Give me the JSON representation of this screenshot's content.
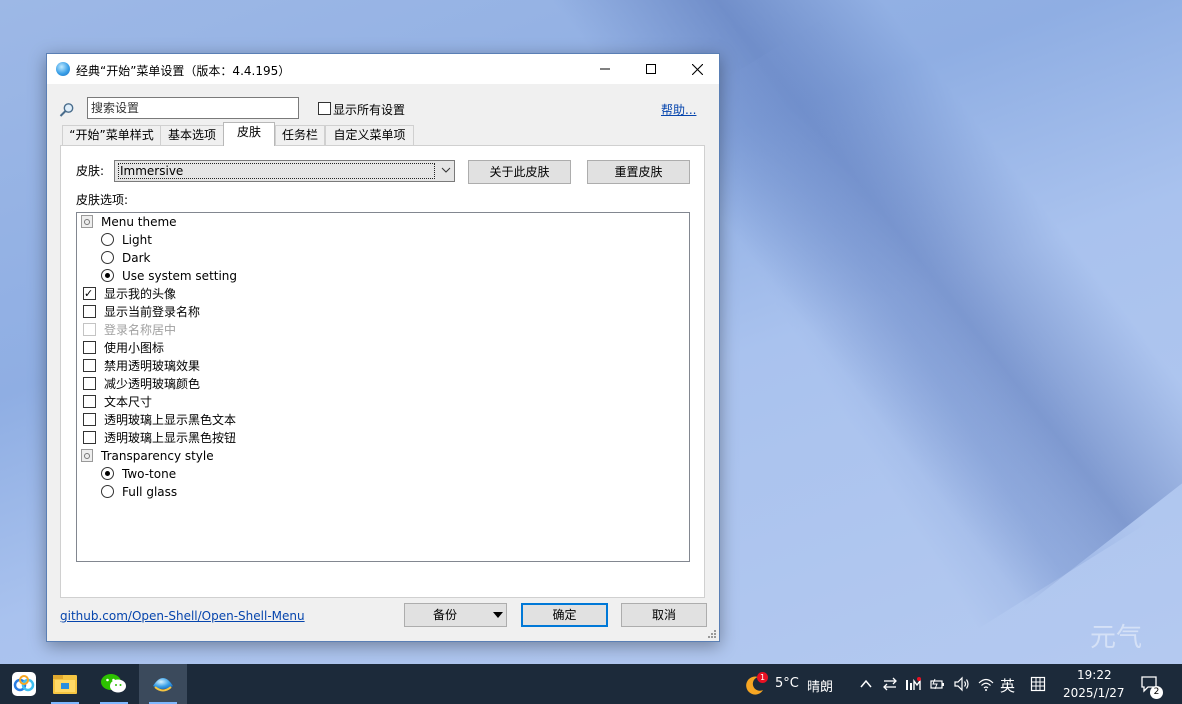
{
  "window": {
    "title": "经典“开始”菜单设置（版本：4.4.195）"
  },
  "search": {
    "placeholder": "搜索设置",
    "show_all_label": "显示所有设置",
    "help_link": "帮助..."
  },
  "tabs": [
    {
      "label": "“开始”菜单样式"
    },
    {
      "label": "基本选项"
    },
    {
      "label": "皮肤",
      "active": true
    },
    {
      "label": "任务栏"
    },
    {
      "label": "自定义菜单项"
    }
  ],
  "skin": {
    "label": "皮肤:",
    "selected": "Immersive",
    "about_button": "关于此皮肤",
    "reset_button": "重置皮肤",
    "options_label": "皮肤选项:"
  },
  "options": [
    {
      "type": "group",
      "label": "Menu theme"
    },
    {
      "type": "radio",
      "label": "Light",
      "checked": false
    },
    {
      "type": "radio",
      "label": "Dark",
      "checked": false
    },
    {
      "type": "radio",
      "label": "Use system setting",
      "checked": true
    },
    {
      "type": "checkbox",
      "label": "显示我的头像",
      "checked": true
    },
    {
      "type": "checkbox",
      "label": "显示当前登录名称",
      "checked": false
    },
    {
      "type": "checkbox",
      "label": "登录名称居中",
      "checked": false,
      "disabled": true
    },
    {
      "type": "checkbox",
      "label": "使用小图标",
      "checked": false
    },
    {
      "type": "checkbox",
      "label": "禁用透明玻璃效果",
      "checked": false
    },
    {
      "type": "checkbox",
      "label": "减少透明玻璃颜色",
      "checked": false
    },
    {
      "type": "checkbox",
      "label": "文本尺寸",
      "checked": false
    },
    {
      "type": "checkbox",
      "label": "透明玻璃上显示黑色文本",
      "checked": false
    },
    {
      "type": "checkbox",
      "label": "透明玻璃上显示黑色按钮",
      "checked": false
    },
    {
      "type": "group",
      "label": "Transparency style"
    },
    {
      "type": "radio",
      "label": "Two-tone",
      "checked": true
    },
    {
      "type": "radio",
      "label": "Full glass",
      "checked": false
    }
  ],
  "footer": {
    "link": "github.com/Open-Shell/Open-Shell-Menu",
    "backup_button": "备份",
    "ok_button": "确定",
    "cancel_button": "取消"
  },
  "taskbar": {
    "apps": [
      "baidu-netdisk-icon",
      "file-explorer-icon",
      "wechat-icon",
      "open-shell-icon"
    ],
    "weather_badge": "1",
    "temperature": "5°C",
    "weather": "晴朗",
    "ime": "英",
    "time": "19:22",
    "date": "2025/1/27",
    "notification_count": "2"
  }
}
